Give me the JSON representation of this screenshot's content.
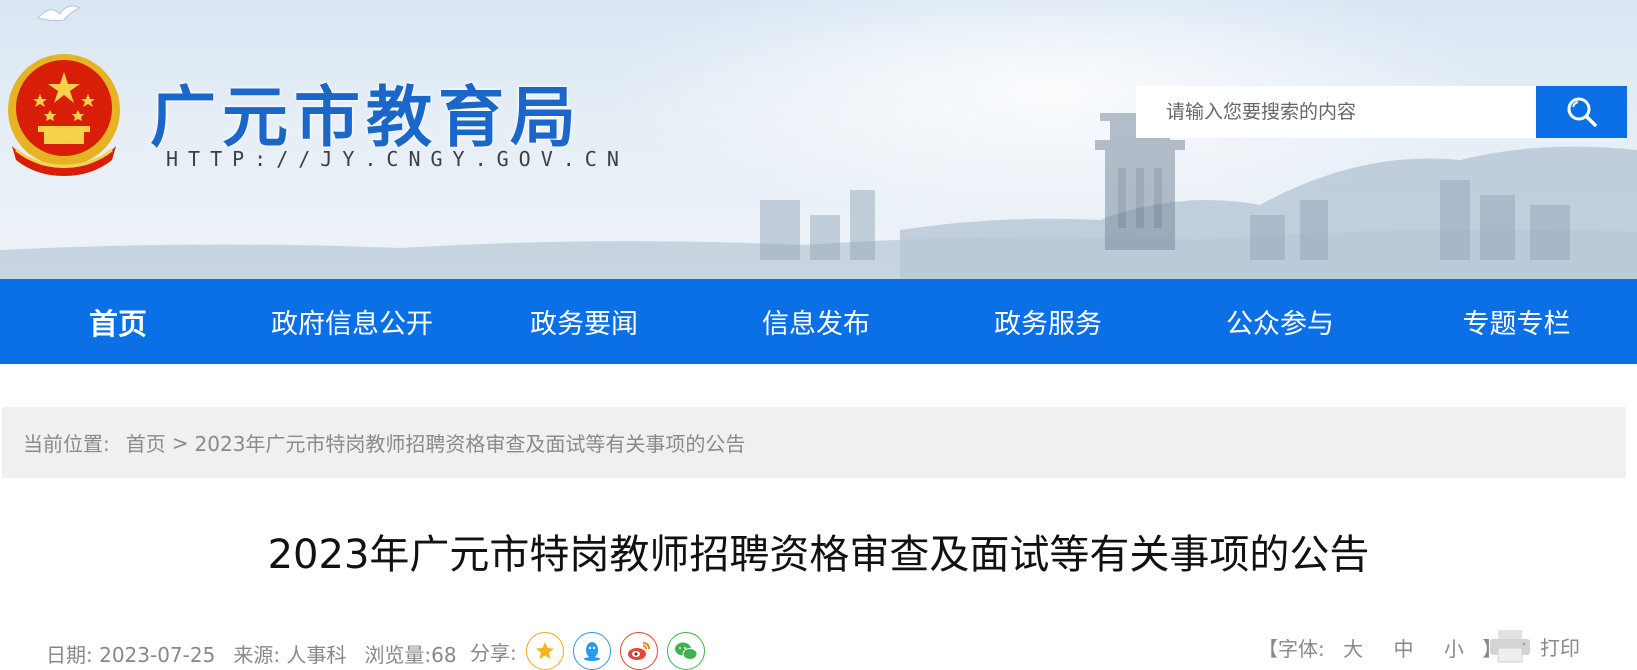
{
  "header": {
    "title": "广元市教育局",
    "url": "HTTP://JY.CNGY.GOV.CN",
    "emblem_icon": "national-emblem-icon"
  },
  "search": {
    "placeholder": "请输入您要搜索的内容",
    "button_icon": "search-icon"
  },
  "nav": {
    "items": [
      {
        "label": "首页"
      },
      {
        "label": "政府信息公开"
      },
      {
        "label": "政务要闻"
      },
      {
        "label": "信息发布"
      },
      {
        "label": "政务服务"
      },
      {
        "label": "公众参与"
      },
      {
        "label": "专题专栏"
      }
    ]
  },
  "breadcrumb": {
    "prefix": "当前位置:",
    "home": "首页",
    "separator": ">",
    "current": "2023年广元市特岗教师招聘资格审查及面试等有关事项的公告"
  },
  "article": {
    "title": "2023年广元市特岗教师招聘资格审查及面试等有关事项的公告",
    "date": "日期: 2023-07-25",
    "source": "来源: 人事科",
    "views": "浏览量:68"
  },
  "share": {
    "label": "分享:",
    "icons": [
      "qzone-icon",
      "qq-icon",
      "weibo-icon",
      "wechat-icon"
    ]
  },
  "font_size": {
    "open": "【字体:",
    "large": "大",
    "medium": "中",
    "small": "小",
    "close": "】"
  },
  "print": {
    "label": "打印",
    "icon": "printer-icon"
  },
  "colors": {
    "nav_bg": "#0b70e6",
    "title_blue": "#1a66c9",
    "breadcrumb_bg": "#f0f0f0"
  }
}
